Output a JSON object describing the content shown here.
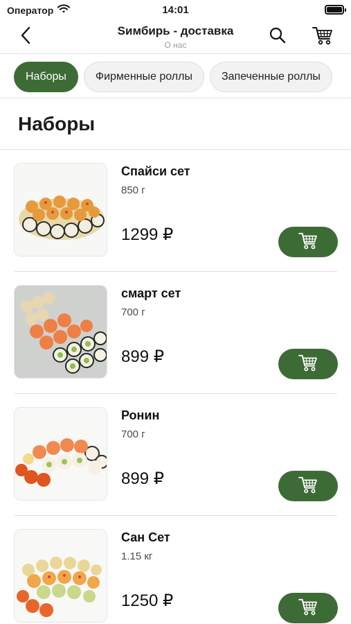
{
  "status_bar": {
    "carrier": "Оператор",
    "time": "14:01"
  },
  "nav": {
    "title": "Sимбирь - доставка",
    "subtitle": "О нас"
  },
  "tabs": [
    {
      "label": "Наборы",
      "active": true
    },
    {
      "label": "Фирменные роллы",
      "active": false
    },
    {
      "label": "Запеченные роллы",
      "active": false
    }
  ],
  "section": {
    "title": "Наборы"
  },
  "products": [
    {
      "name": "Спайси сет",
      "weight": "850 г",
      "price": "1299 ₽"
    },
    {
      "name": "смарт сет",
      "weight": "700 г",
      "price": "899 ₽"
    },
    {
      "name": "Ронин",
      "weight": "700 г",
      "price": "899 ₽"
    },
    {
      "name": "Сан Сет",
      "weight": "1.15 кг",
      "price": "1250 ₽"
    }
  ],
  "icons": {
    "back": "chevron-left-icon",
    "search": "search-icon",
    "cart": "cart-icon",
    "wifi": "wifi-icon",
    "battery": "battery-icon"
  },
  "colors": {
    "accent": "#3d6b35",
    "tab_inactive_bg": "#f2f2f2",
    "divider": "#e0e0e0"
  }
}
